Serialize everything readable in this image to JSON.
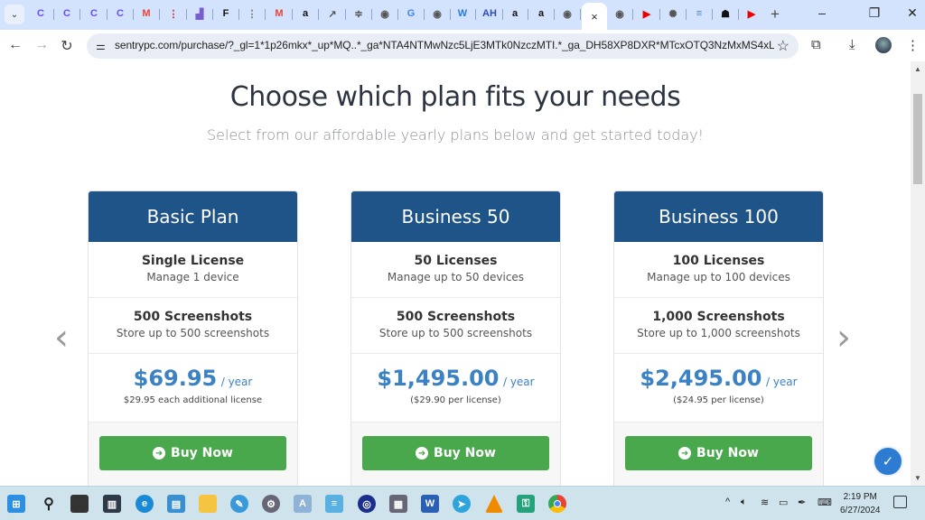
{
  "browser": {
    "tabs": [
      {
        "icon": "canva-icon",
        "glyph": "C",
        "color": "#6a4cf0"
      },
      {
        "icon": "canva-icon",
        "glyph": "C",
        "color": "#6a4cf0"
      },
      {
        "icon": "canva-icon",
        "glyph": "C",
        "color": "#6a4cf0"
      },
      {
        "icon": "canva-icon",
        "glyph": "C",
        "color": "#6a4cf0"
      },
      {
        "icon": "gmail-icon",
        "glyph": "M",
        "color": "#ea4335"
      },
      {
        "icon": "traffic-light-icon",
        "glyph": "⋮",
        "color": "#c33"
      },
      {
        "icon": "chart-app-icon",
        "glyph": "▟",
        "color": "#7a5cd0"
      },
      {
        "icon": "f-logo-icon",
        "glyph": "F",
        "color": "#111"
      },
      {
        "icon": "dots-icon",
        "glyph": "⋮",
        "color": "#777"
      },
      {
        "icon": "gmail-icon",
        "glyph": "M",
        "color": "#ea4335"
      },
      {
        "icon": "amazon-icon",
        "glyph": "a",
        "color": "#111"
      },
      {
        "icon": "trend-icon",
        "glyph": "↗",
        "color": "#555"
      },
      {
        "icon": "vpn-icon",
        "glyph": "≑",
        "color": "#555"
      },
      {
        "icon": "globe-icon",
        "glyph": "◉",
        "color": "#555"
      },
      {
        "icon": "google-icon",
        "glyph": "G",
        "color": "#4285f4"
      },
      {
        "icon": "globe-icon",
        "glyph": "◉",
        "color": "#555"
      },
      {
        "icon": "wix-icon",
        "glyph": "W",
        "color": "#2a7ae2"
      },
      {
        "icon": "ah-icon",
        "glyph": "AH",
        "color": "#2b4db0"
      },
      {
        "icon": "amazon-icon",
        "glyph": "a",
        "color": "#111"
      },
      {
        "icon": "amazon-icon",
        "glyph": "a",
        "color": "#111"
      },
      {
        "icon": "globe-icon",
        "glyph": "◉",
        "color": "#555"
      },
      {
        "icon": "globe-icon",
        "glyph": "◉",
        "color": "#555"
      },
      {
        "icon": "youtube-icon",
        "glyph": "▶",
        "color": "#e00"
      },
      {
        "icon": "openai-icon",
        "glyph": "✺",
        "color": "#555"
      },
      {
        "icon": "docs-icon",
        "glyph": "≡",
        "color": "#4285f4"
      },
      {
        "icon": "spy-icon",
        "glyph": "☗",
        "color": "#111"
      },
      {
        "icon": "youtube-icon",
        "glyph": "▶",
        "color": "#e00"
      }
    ],
    "active_tab_close": "×",
    "new_tab": "+",
    "url": "sentrypc.com/purchase/?_gl=1*1p26mkx*_up*MQ..*_ga*NTA4NTMwNzc5LjE3MTk0NzczMTI.*_ga_DH58XP8DXR*MTcxOTQ3NzMxMS4xLjEuMTcxO..."
  },
  "page": {
    "title": "Choose which plan fits your needs",
    "subtitle": "Select from our affordable yearly plans below and get started today!",
    "plans": [
      {
        "name": "Basic Plan",
        "license_title": "Single License",
        "license_desc": "Manage 1 device",
        "screens_title": "500 Screenshots",
        "screens_desc": "Store up to 500 screenshots",
        "price": "$69.95",
        "period": "/ year",
        "note": "$29.95 each additional license",
        "button": "Buy Now"
      },
      {
        "name": "Business 50",
        "license_title": "50 Licenses",
        "license_desc": "Manage up to 50 devices",
        "screens_title": "500 Screenshots",
        "screens_desc": "Store up to 500 screenshots",
        "price": "$1,495.00",
        "period": "/ year",
        "note": "($29.90 per license)",
        "button": "Buy Now"
      },
      {
        "name": "Business 100",
        "license_title": "100 Licenses",
        "license_desc": "Manage up to 100 devices",
        "screens_title": "1,000 Screenshots",
        "screens_desc": "Store up to 1,000 screenshots",
        "price": "$2,495.00",
        "period": "/ year",
        "note": "($24.95 per license)",
        "button": "Buy Now"
      }
    ],
    "prev_arrow": "‹",
    "next_arrow": "›",
    "colors": {
      "header": "#1f5488",
      "price": "#3b82c4",
      "button": "#4aa84c"
    }
  },
  "taskbar": {
    "time": "2:19 PM",
    "date": "6/27/2024"
  }
}
